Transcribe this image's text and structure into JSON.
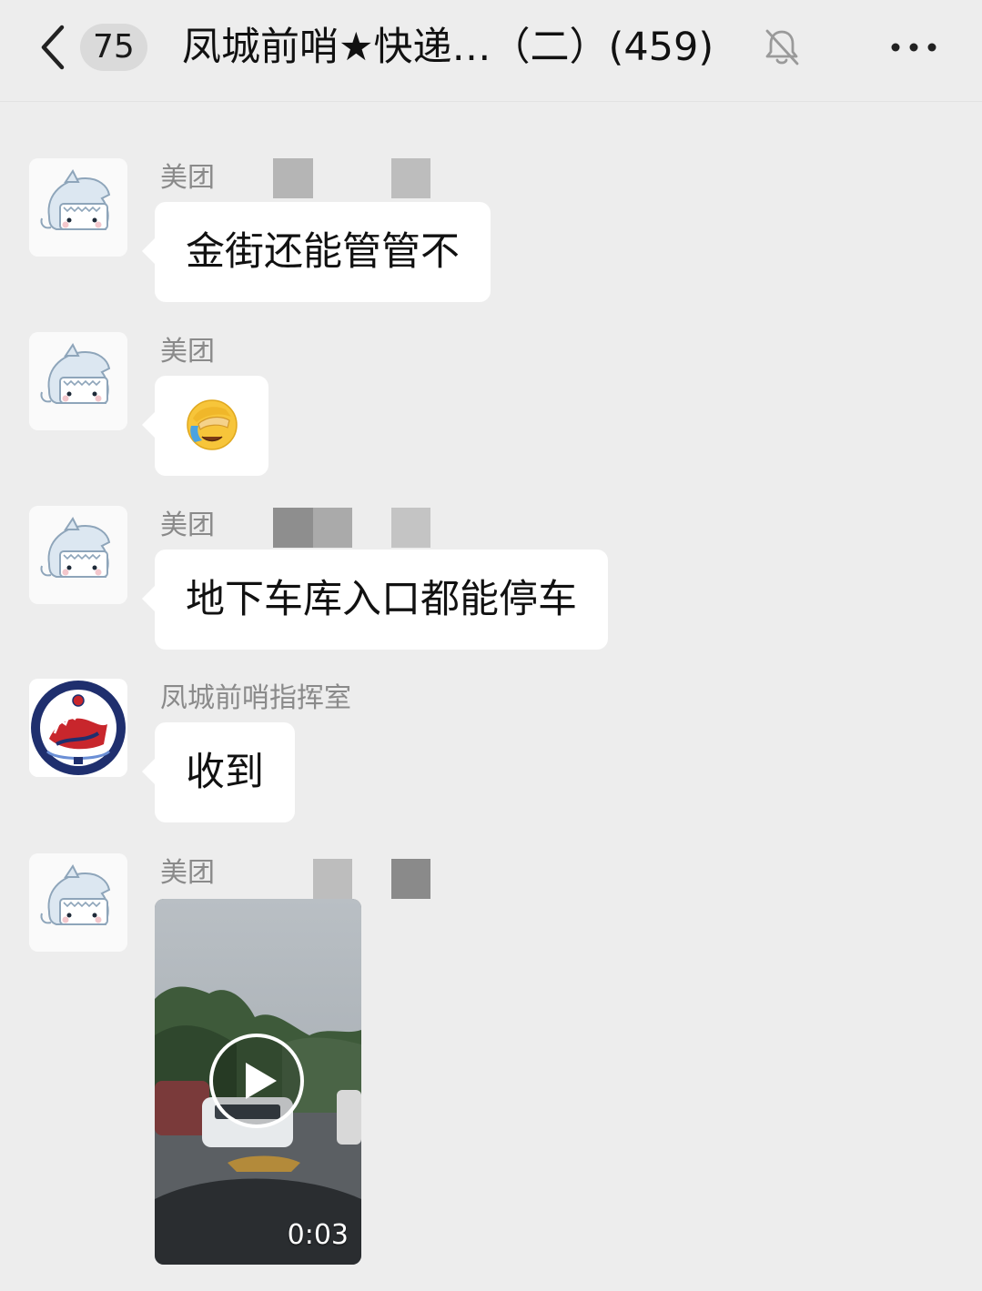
{
  "header": {
    "back_icon": "chevron-left-icon",
    "unread_count": "75",
    "title": "凤城前哨★快递…（二）(459)",
    "mute_icon": "bell-off-icon",
    "more_icon": "more-horizontal-icon"
  },
  "messages": [
    {
      "sender": "美团",
      "text": "金街还能管管不"
    },
    {
      "sender": "美团",
      "emoji": "face-with-hand-over-eyes-crying"
    },
    {
      "sender": "美团",
      "text": "地下车库入口都能停车"
    },
    {
      "sender": "凤城前哨指挥室",
      "text": "收到"
    },
    {
      "sender": "美团",
      "video": {
        "duration": "0:03",
        "icon": "play-icon"
      }
    }
  ],
  "colors": {
    "background": "#ededed",
    "bubble": "#ffffff",
    "sender_name": "#8a8a8a"
  }
}
